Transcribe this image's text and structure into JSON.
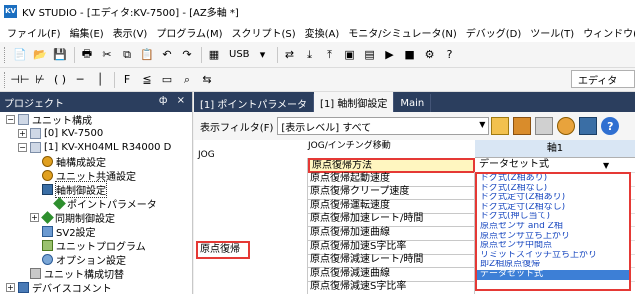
{
  "app": {
    "title": "KV STUDIO - [エディタ:KV-7500] - [AZ多軸 *]",
    "icon_text": "KV"
  },
  "menu": [
    "ファイル(F)",
    "編集(E)",
    "表示(V)",
    "プログラム(M)",
    "スクリプト(S)",
    "変換(A)",
    "モニタ/シミュレータ(N)",
    "デバッグ(D)",
    "ツール(T)",
    "ウィンドウ(W)",
    "ヘルプ(H)"
  ],
  "toolbar": {
    "connection": "USB",
    "editor_mode": "エディタ"
  },
  "project": {
    "header": "プロジェクト",
    "pin": "ф ×",
    "items": [
      {
        "toggle": "−",
        "label": "ユニット構成"
      },
      {
        "toggle": "+",
        "label": "[0]  KV-7500"
      },
      {
        "toggle": "−",
        "label": "[1]  KV-XH04ML    R34000  D"
      },
      {
        "toggle": "",
        "label": "軸構成設定"
      },
      {
        "toggle": "",
        "label": "ユニット共通設定"
      },
      {
        "toggle": "",
        "label": "軸制御設定"
      },
      {
        "toggle": "",
        "label": "ポイントパラメータ"
      },
      {
        "toggle": "+",
        "label": "同期制御設定"
      },
      {
        "toggle": "",
        "label": "SV2設定"
      },
      {
        "toggle": "",
        "label": "ユニットプログラム"
      },
      {
        "toggle": "",
        "label": "オプション設定"
      },
      {
        "toggle": "",
        "label": "ユニット構成切替"
      },
      {
        "toggle": "+",
        "label": "デバイスコメント"
      }
    ]
  },
  "tabs": [
    {
      "label": "[1] ポイントパラメータ",
      "active": false
    },
    {
      "label": "[1] 軸制御設定",
      "active": true
    },
    {
      "label": "Main",
      "active": false
    }
  ],
  "filter": {
    "label": "表示フィルタ(F)",
    "value": "[表示レベル] すべて"
  },
  "grid": {
    "axis_header": "軸1",
    "cut_row": "JOG/インチング移動",
    "jog_label": "JOG",
    "group_label": "原点復帰",
    "rows": [
      {
        "label": "原点復帰方法",
        "value": "データセット式",
        "highlighted": true
      },
      {
        "label": "原点復帰起動速度",
        "value": ""
      },
      {
        "label": "原点復帰クリープ速度",
        "value": ""
      },
      {
        "label": "原点復帰運転速度",
        "value": ""
      },
      {
        "label": "原点復帰加速レート/時間",
        "value": ""
      },
      {
        "label": "原点復帰加速曲線",
        "value": ""
      },
      {
        "label": "原点復帰加速S字比率",
        "value": ""
      },
      {
        "label": "原点復帰減速レート/時間",
        "value": ""
      },
      {
        "label": "原点復帰減速曲線",
        "value": ""
      },
      {
        "label": "原点復帰減速S字比率",
        "value": ""
      }
    ]
  },
  "dropdown": {
    "options": [
      "ドグ式(Z相あり)",
      "ドグ式(Z相なし)",
      "ドグ式定寸(Z相あり)",
      "ドグ式定寸(Z相なし)",
      "ドグ式(押し当て)",
      "原点センサ and Z相",
      "原点センサ立ち上がり",
      "原点センサ中間点",
      "リミットスイッチ立ち上がり",
      "即Z相原点復帰",
      "データセット式"
    ],
    "selected": "データセット式"
  }
}
